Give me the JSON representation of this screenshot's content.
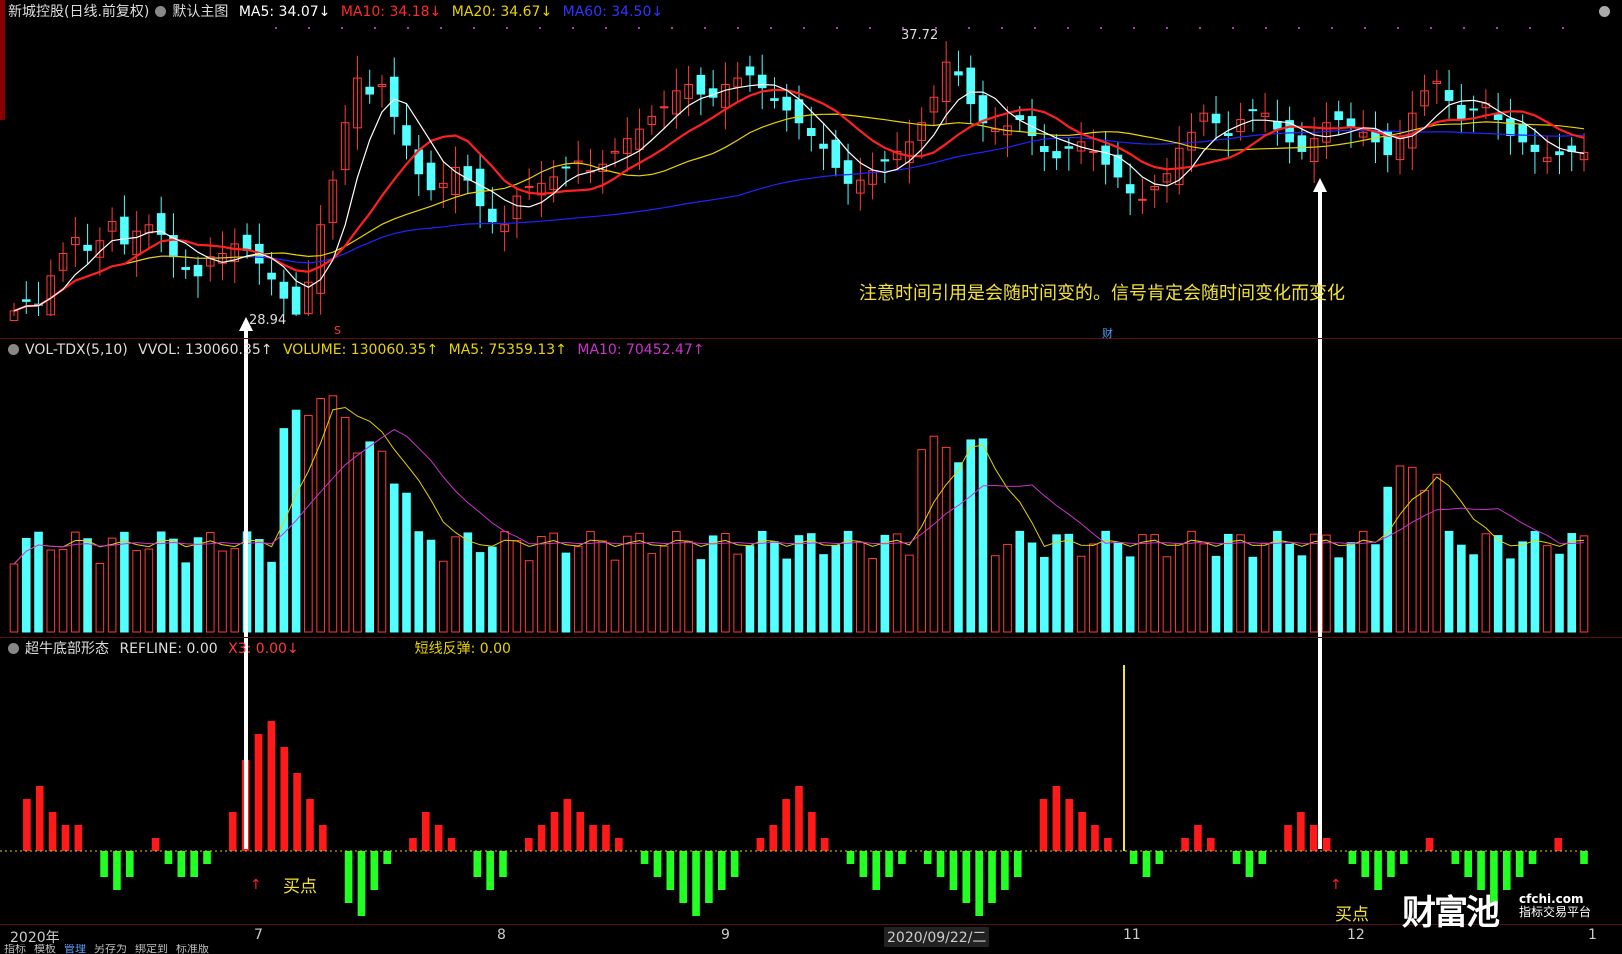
{
  "main_panel": {
    "stock_name": "新城控股(日线.前复权)",
    "template": "默认主图",
    "ma5": "MA5: 34.07↓",
    "ma10": "MA10: 34.18↓",
    "ma20": "MA20: 34.67↓",
    "ma60": "MA60: 34.50↓",
    "high_label": "37.72",
    "low_label": "28.94",
    "note": "注意时间引用是会随时间变的。信号肯定会随时间变化而变化",
    "s_marker": "S",
    "cai_marker": "财"
  },
  "volume_panel": {
    "indicator": "VOL-TDX(5,10)",
    "vvol": "VVOL: 130060.35↑",
    "volume": "VOLUME: 130060.35↑",
    "ma5": "MA5: 75359.13↑",
    "ma10": "MA10: 70452.47↑"
  },
  "indicator_panel": {
    "name": "超牛底部形态",
    "refline": "REFLINE: 0.00",
    "x3": "X3: 0.00↓",
    "short_rebound": "短线反弹: 0.00",
    "buy_label_1": "买点",
    "buy_label_2": "买点"
  },
  "x_axis": {
    "year": "2020年",
    "m7": "7",
    "m8": "8",
    "m9": "9",
    "cursor_date": "2020/09/22/二",
    "m11": "11",
    "m12": "12",
    "m1": "1"
  },
  "footer": {
    "items": [
      "指标",
      "模板",
      "管理",
      "另存为",
      "绑定到",
      "标准版"
    ]
  },
  "brand": {
    "name": "财富池",
    "domain": "cfchi.com",
    "tagline": "指标交易平台"
  },
  "colors": {
    "up": "#ff3b3b",
    "down": "#54ffff",
    "ma5": "#ffffff",
    "ma10": "#ff2020",
    "ma20": "#e8d200",
    "ma60": "#2222ff",
    "vol_ma10": "#cc33cc",
    "ind_up": "#ff1a1a",
    "ind_down": "#22ff22",
    "yellow": "#f2e23a"
  },
  "chart_data": {
    "type": "candlestick",
    "y_range_visible": [
      28.94,
      37.72
    ],
    "closes": [
      29.1,
      29.4,
      29.3,
      30.2,
      30.9,
      31.4,
      31.0,
      31.3,
      31.9,
      31.2,
      31.6,
      31.8,
      31.5,
      30.8,
      30.4,
      30.2,
      30.8,
      30.9,
      31.2,
      31.0,
      30.6,
      30.1,
      29.5,
      29.0,
      30.0,
      31.8,
      33.2,
      35.0,
      36.4,
      35.9,
      36.2,
      35.2,
      34.3,
      33.4,
      32.9,
      33.1,
      33.6,
      33.2,
      32.4,
      31.9,
      31.8,
      32.7,
      33.0,
      33.1,
      33.3,
      33.6,
      33.8,
      33.5,
      33.7,
      34.1,
      34.5,
      34.8,
      35.2,
      35.5,
      36.0,
      36.2,
      35.9,
      35.8,
      36.2,
      36.4,
      36.5,
      36.1,
      35.7,
      35.4,
      35.0,
      34.6,
      34.2,
      33.6,
      33.1,
      33.2,
      33.5,
      33.8,
      34.1,
      34.4,
      35.0,
      35.8,
      36.9,
      36.5,
      35.6,
      35.0,
      34.8,
      34.9,
      35.1,
      34.6,
      34.1,
      33.9,
      34.2,
      34.4,
      34.1,
      33.7,
      33.3,
      32.8,
      32.6,
      33.0,
      33.4,
      34.2,
      34.7,
      35.3,
      35.0,
      34.6,
      35.1,
      35.4,
      35.3,
      34.8,
      34.4,
      34.1,
      34.5,
      35.0,
      35.1,
      34.9,
      34.7,
      34.4,
      34.0,
      34.5,
      35.3,
      36.0,
      36.3,
      35.7,
      35.1,
      35.4,
      35.6,
      35.1,
      34.6,
      34.4,
      34.1,
      33.9,
      34.0,
      34.1,
      34.07
    ],
    "high": 37.72,
    "low": 28.94,
    "volume_max": 200000,
    "indicator_series": [
      0,
      4,
      5,
      3,
      2,
      2,
      0,
      -2,
      -3,
      -2,
      0,
      1,
      -1,
      -2,
      -2,
      -1,
      0,
      3,
      7,
      9,
      10,
      8,
      6,
      4,
      2,
      0,
      -4,
      -5,
      -3,
      -1,
      0,
      1,
      3,
      2,
      1,
      0,
      -2,
      -3,
      -2,
      0,
      1,
      2,
      3,
      4,
      3,
      2,
      2,
      1,
      0,
      -1,
      -2,
      -3,
      -4,
      -5,
      -4,
      -3,
      -2,
      0,
      1,
      2,
      4,
      5,
      3,
      1,
      0,
      -1,
      -2,
      -3,
      -2,
      -1,
      0,
      -1,
      -2,
      -3,
      -4,
      -5,
      -4,
      -3,
      -2,
      0,
      4,
      5,
      4,
      3,
      2,
      1,
      0,
      -1,
      -2,
      -1,
      0,
      1,
      2,
      1,
      0,
      -1,
      -2,
      -1,
      0,
      2,
      3,
      2,
      1,
      0,
      -1,
      -2,
      -3,
      -2,
      -1,
      0,
      1,
      0,
      -1,
      -2,
      -3,
      -4,
      -3,
      -2,
      -1,
      0,
      1,
      0,
      -1
    ]
  }
}
